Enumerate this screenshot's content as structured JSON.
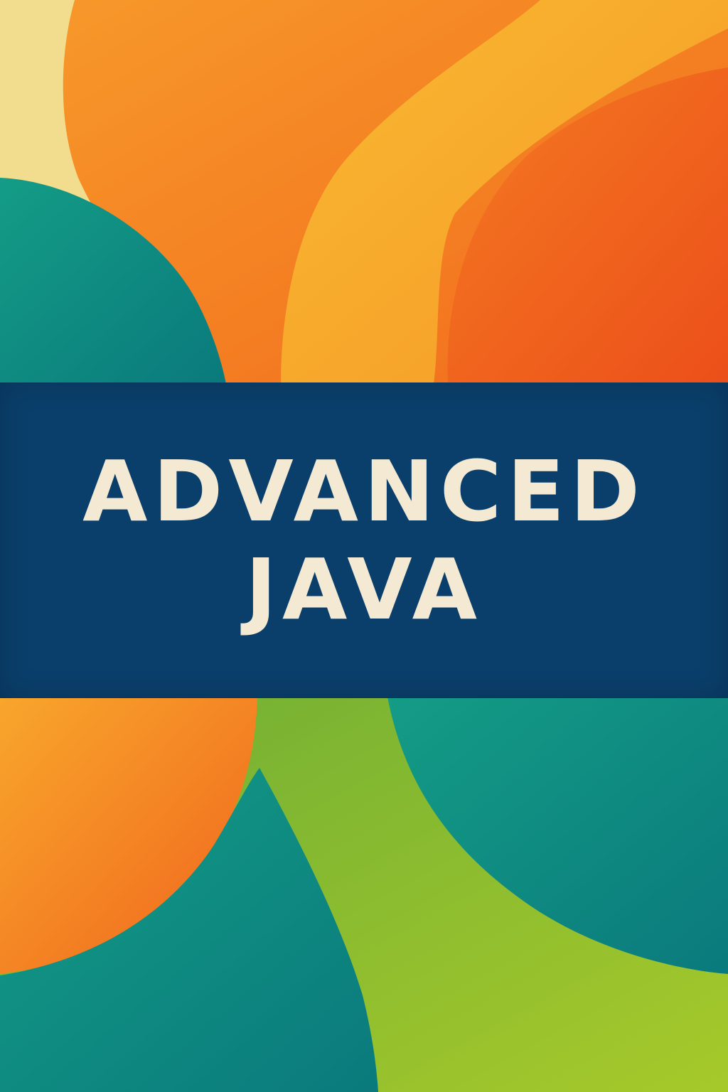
{
  "cover": {
    "title_line_1": "ADVANCED",
    "title_line_2": "JAVA"
  },
  "palette": {
    "cream": "#f2dc8e",
    "orange": "#f47a1f",
    "red_orange": "#ef5a1c",
    "amber": "#f7a82a",
    "teal": "#0f8a7e",
    "deep_teal": "#0a7480",
    "lime": "#8fbf2c",
    "navy_band": "#0a3f6b",
    "title_text": "#f4ead4"
  }
}
